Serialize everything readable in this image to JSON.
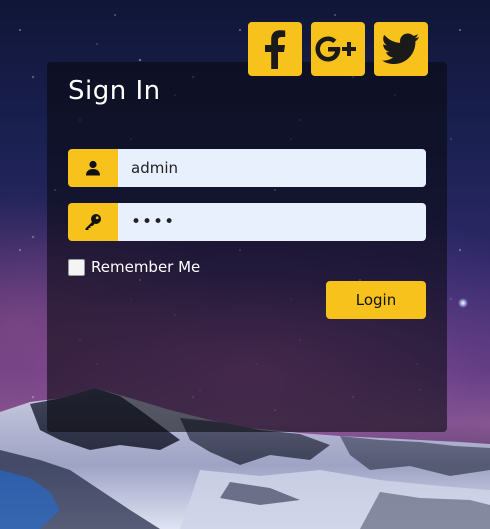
{
  "social": {
    "buttons": [
      {
        "name": "facebook",
        "icon": "facebook-icon",
        "glyph": "f"
      },
      {
        "name": "google-plus",
        "icon": "google-plus-icon",
        "glyph": "G+"
      },
      {
        "name": "twitter",
        "icon": "twitter-icon",
        "glyph": "bird"
      }
    ]
  },
  "form": {
    "title": "Sign In",
    "username": {
      "value": "admin",
      "icon": "user-icon"
    },
    "password": {
      "value": "••••",
      "icon": "key-icon"
    },
    "remember_label": "Remember Me",
    "remember_checked": false,
    "login_label": "Login"
  },
  "colors": {
    "accent": "#f6c21b",
    "input_bg": "#e8f0fe",
    "panel_bg": "rgba(8,8,14,0.58)"
  }
}
